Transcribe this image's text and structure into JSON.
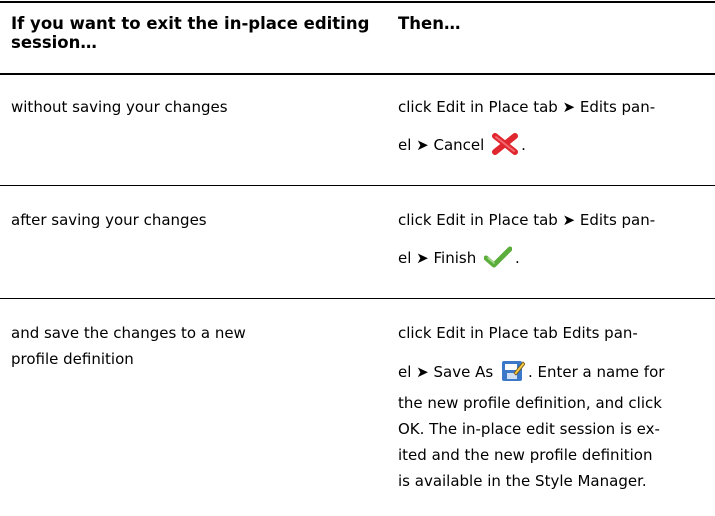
{
  "table": {
    "headers": [
      "If you want to exit the in-place editing session…",
      "Then…"
    ],
    "rows": [
      {
        "condition": "without saving your changes",
        "action_l1": "click Edit in Place tab ➤ Edits pan-",
        "action_l2_a": "el ➤ Cancel",
        "action_l2_b": ".",
        "icon": "cancel-x-icon"
      },
      {
        "condition": "after saving your changes",
        "action_l1": "click Edit in Place tab ➤ Edits pan-",
        "action_l2_a": "el ➤ Finish",
        "action_l2_b": ".",
        "icon": "finish-check-icon"
      },
      {
        "condition_l1": "and save the changes to a new",
        "condition_l2": "profile definition",
        "action_l1": "click Edit in Place tab Edits pan-",
        "action_l2_a": "el ➤ Save As",
        "action_l2_b": ". Enter a name for",
        "action_l3": "the new profile definition, and click",
        "action_l4": "OK. The in-place edit session is ex-",
        "action_l5": "ited and the new profile definition",
        "action_l6": "is available in the Style Manager.",
        "icon": "save-as-icon"
      }
    ]
  },
  "colors": {
    "cancel": "#e0262e",
    "finish": "#5cae3c",
    "save_as": "#3b78c8"
  }
}
